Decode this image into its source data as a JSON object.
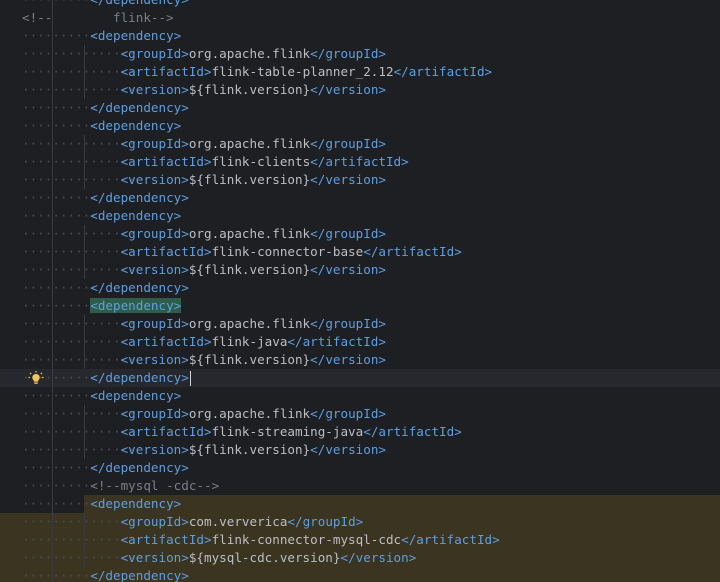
{
  "editor": {
    "lines": [
      {
        "indent": 2,
        "guides": 1,
        "text": "</dependency>",
        "kind": "tag"
      },
      {
        "indent": 0,
        "guides": 1,
        "text": "<!--        flink-->",
        "kind": "comment"
      },
      {
        "indent": 2,
        "guides": 1,
        "text": "<dependency>",
        "kind": "tag"
      },
      {
        "indent": 3,
        "guides": 2,
        "open": "<groupId>",
        "value": "org.apache.flink",
        "close": "</groupId>",
        "kind": "elem"
      },
      {
        "indent": 3,
        "guides": 2,
        "open": "<artifactId>",
        "value": "flink-table-planner_2.12",
        "close": "</artifactId>",
        "kind": "elem"
      },
      {
        "indent": 3,
        "guides": 2,
        "open": "<version>",
        "value": "${flink.version}",
        "close": "</version>",
        "kind": "elem"
      },
      {
        "indent": 2,
        "guides": 1,
        "text": "</dependency>",
        "kind": "tag"
      },
      {
        "indent": 2,
        "guides": 1,
        "text": "<dependency>",
        "kind": "tag"
      },
      {
        "indent": 3,
        "guides": 2,
        "open": "<groupId>",
        "value": "org.apache.flink",
        "close": "</groupId>",
        "kind": "elem"
      },
      {
        "indent": 3,
        "guides": 2,
        "open": "<artifactId>",
        "value": "flink-clients",
        "close": "</artifactId>",
        "kind": "elem"
      },
      {
        "indent": 3,
        "guides": 2,
        "open": "<version>",
        "value": "${flink.version}",
        "close": "</version>",
        "kind": "elem"
      },
      {
        "indent": 2,
        "guides": 1,
        "text": "</dependency>",
        "kind": "tag"
      },
      {
        "indent": 2,
        "guides": 1,
        "text": "<dependency>",
        "kind": "tag"
      },
      {
        "indent": 3,
        "guides": 2,
        "open": "<groupId>",
        "value": "org.apache.flink",
        "close": "</groupId>",
        "kind": "elem"
      },
      {
        "indent": 3,
        "guides": 2,
        "open": "<artifactId>",
        "value": "flink-connector-base",
        "close": "</artifactId>",
        "kind": "elem"
      },
      {
        "indent": 3,
        "guides": 2,
        "open": "<version>",
        "value": "${flink.version}",
        "close": "</version>",
        "kind": "elem"
      },
      {
        "indent": 2,
        "guides": 1,
        "text": "</dependency>",
        "kind": "tag"
      },
      {
        "indent": 2,
        "guides": 1,
        "text": "<dependency>",
        "kind": "tag",
        "match": true
      },
      {
        "indent": 3,
        "guides": 2,
        "open": "<groupId>",
        "value": "org.apache.flink",
        "close": "</groupId>",
        "kind": "elem"
      },
      {
        "indent": 3,
        "guides": 2,
        "open": "<artifactId>",
        "value": "flink-java",
        "close": "</artifactId>",
        "kind": "elem"
      },
      {
        "indent": 3,
        "guides": 2,
        "open": "<version>",
        "value": "${flink.version}",
        "close": "</version>",
        "kind": "elem"
      },
      {
        "indent": 2,
        "guides": 1,
        "text": "</dependency>",
        "kind": "tag",
        "caret": true,
        "bulb": true
      },
      {
        "indent": 2,
        "guides": 1,
        "text": "<dependency>",
        "kind": "tag"
      },
      {
        "indent": 3,
        "guides": 2,
        "open": "<groupId>",
        "value": "org.apache.flink",
        "close": "</groupId>",
        "kind": "elem"
      },
      {
        "indent": 3,
        "guides": 2,
        "open": "<artifactId>",
        "value": "flink-streaming-java",
        "close": "</artifactId>",
        "kind": "elem"
      },
      {
        "indent": 3,
        "guides": 2,
        "open": "<version>",
        "value": "${flink.version}",
        "close": "</version>",
        "kind": "elem"
      },
      {
        "indent": 2,
        "guides": 1,
        "text": "</dependency>",
        "kind": "tag"
      },
      {
        "indent": 2,
        "guides": 1,
        "text": "<!--mysql -cdc-->",
        "kind": "comment"
      },
      {
        "indent": 2,
        "guides": 1,
        "text": "<dependency>",
        "kind": "tag",
        "hl": "partial"
      },
      {
        "indent": 3,
        "guides": 2,
        "open": "<groupId>",
        "value": "com.ververica",
        "close": "</groupId>",
        "kind": "elem",
        "hl": "full"
      },
      {
        "indent": 3,
        "guides": 2,
        "open": "<artifactId>",
        "value": "flink-connector-mysql-cdc",
        "close": "</artifactId>",
        "kind": "elem",
        "hl": "full"
      },
      {
        "indent": 3,
        "guides": 2,
        "open": "<version>",
        "value": "${mysql-cdc.version}",
        "close": "</version>",
        "kind": "elem",
        "hl": "full"
      },
      {
        "indent": 2,
        "guides": 1,
        "text": "</dependency>",
        "kind": "tag",
        "hl": "full"
      }
    ]
  },
  "colors": {
    "background": "#1e1f22",
    "tag": "#5f9ee0",
    "text": "#bcbec4",
    "comment": "#7a7e85",
    "highlight": "#3b3420",
    "tag_match": "#2e5e4a"
  },
  "icons": {
    "intention": "lightbulb-icon"
  }
}
